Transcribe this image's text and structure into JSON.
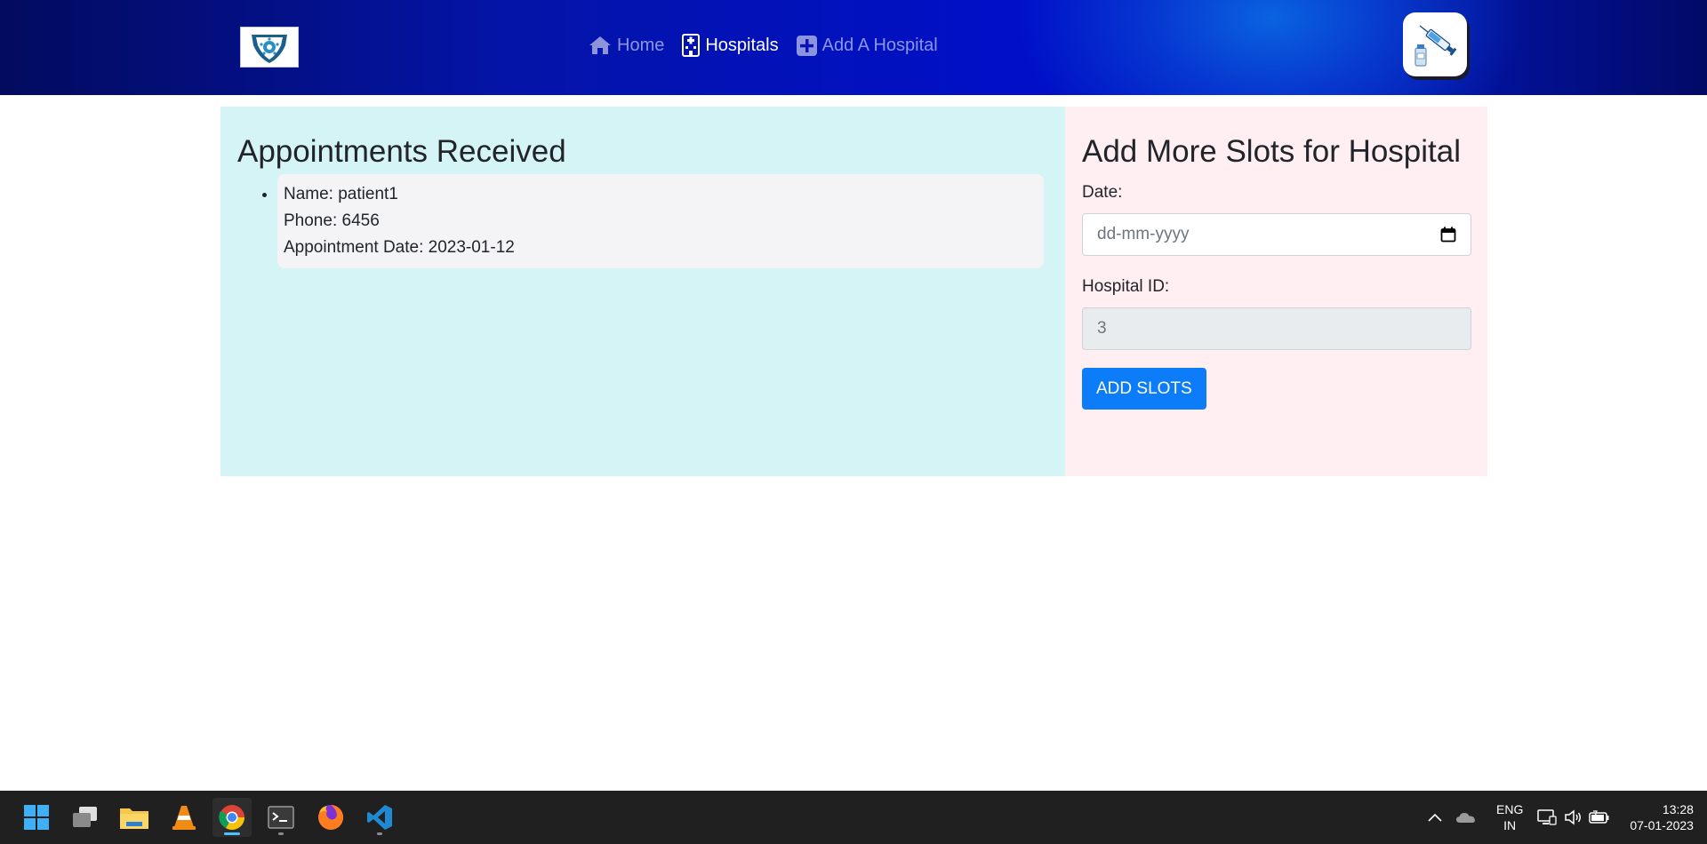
{
  "navbar": {
    "links": [
      {
        "label": "Home",
        "icon": "home-icon",
        "active": false
      },
      {
        "label": "Hospitals",
        "icon": "hospital-icon",
        "active": true
      },
      {
        "label": "Add A Hospital",
        "icon": "plus-square-icon",
        "active": false
      }
    ],
    "brand_icon": "shield-logo",
    "right_icon": "syringe-vaccine-icon"
  },
  "appointments": {
    "title": "Appointments Received",
    "items": [
      {
        "name": "Name: patient1",
        "phone": "Phone: 6456",
        "date": "Appointment Date: 2023-01-12"
      }
    ]
  },
  "slots_form": {
    "title": "Add More Slots for Hospital",
    "date_label": "Date:",
    "date_placeholder": "dd-mm-yyyy",
    "hospital_id_label": "Hospital ID:",
    "hospital_id_value": "3",
    "submit_label": "ADD SLOTS"
  },
  "taskbar": {
    "apps": [
      "windows-start-icon",
      "task-view-icon",
      "file-explorer-icon",
      "vlc-icon",
      "chrome-icon",
      "terminal-icon",
      "firefox-icon",
      "vscode-icon"
    ],
    "active_app": "chrome-icon",
    "language": "ENG",
    "region": "IN",
    "time": "13:28",
    "date": "07-01-2023"
  },
  "colors": {
    "left_panel": "#d5f4f6",
    "right_panel": "#ffeef2",
    "button": "#0d7cf8",
    "navbar": "#0010c8"
  }
}
